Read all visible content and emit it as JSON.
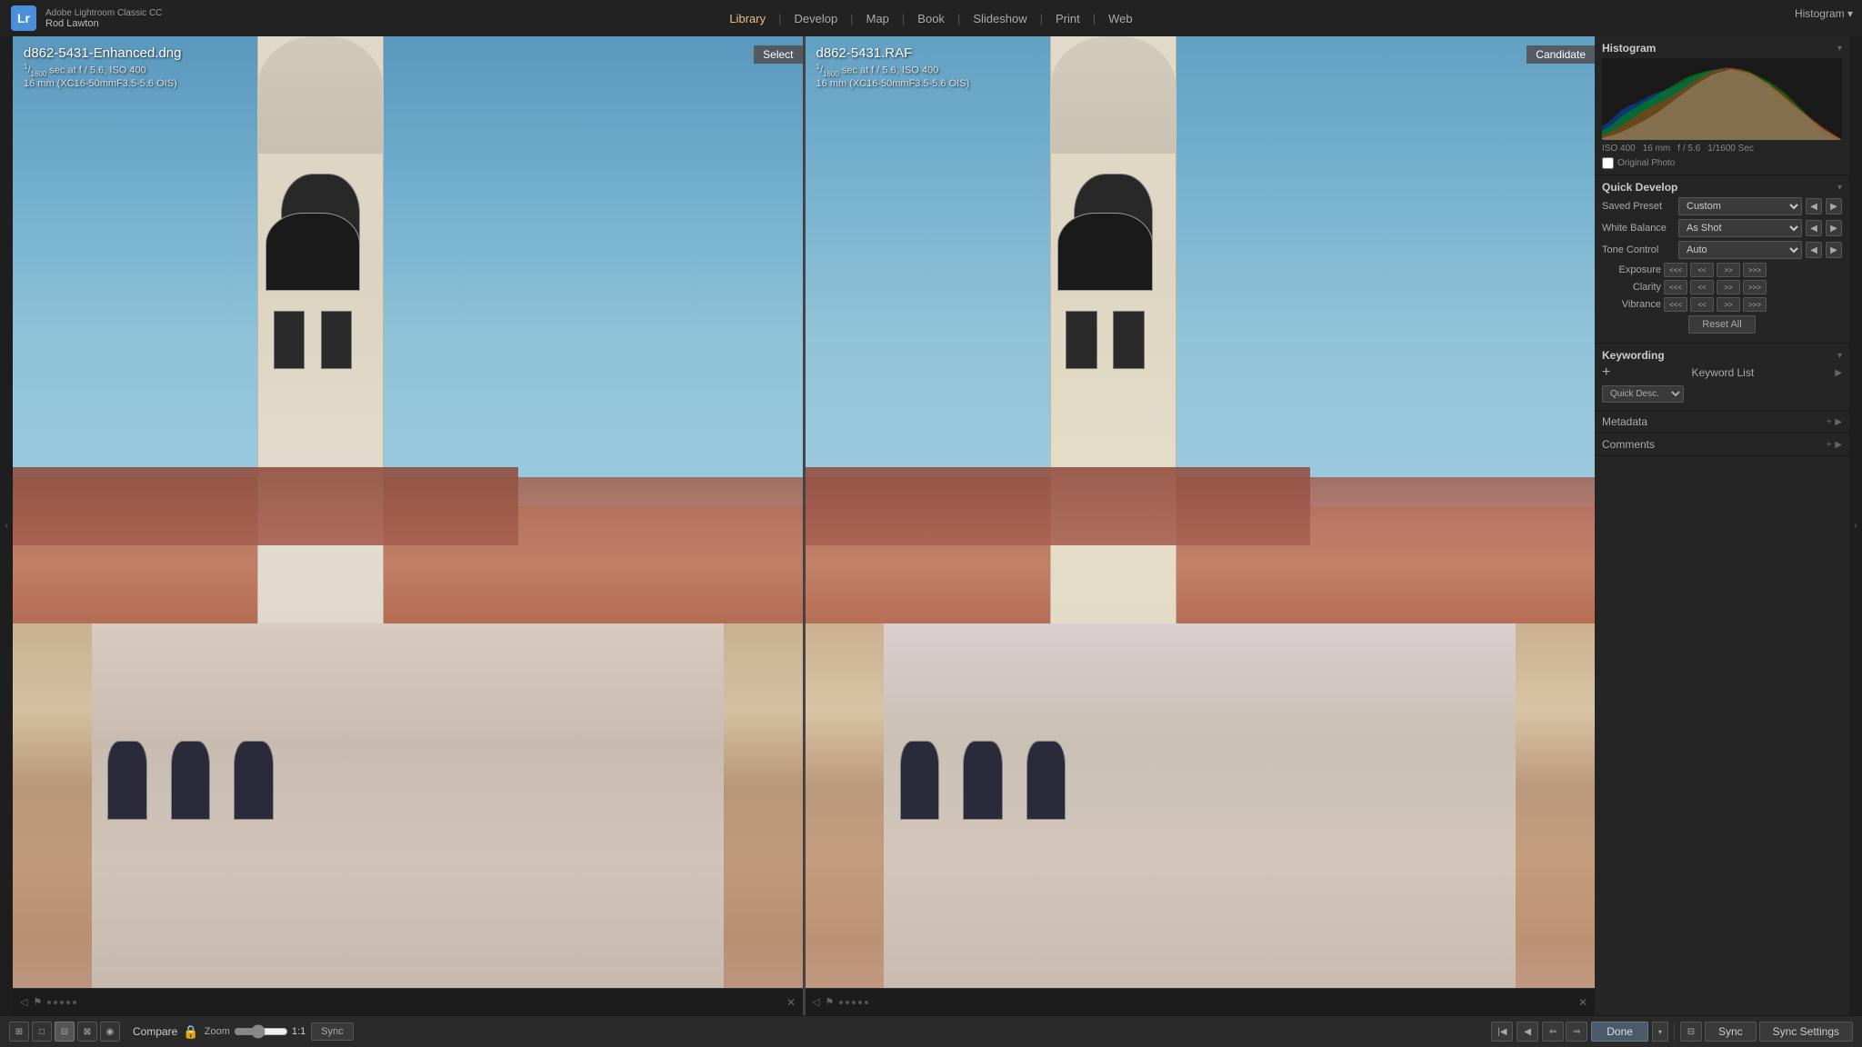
{
  "app": {
    "logo": "Lr",
    "title": "Adobe Lightroom Classic CC",
    "user": "Rod Lawton"
  },
  "nav": {
    "items": [
      {
        "label": "Library",
        "active": true
      },
      {
        "label": "Develop",
        "active": false
      },
      {
        "label": "Map",
        "active": false
      },
      {
        "label": "Book",
        "active": false
      },
      {
        "label": "Slideshow",
        "active": false
      },
      {
        "label": "Print",
        "active": false
      },
      {
        "label": "Web",
        "active": false
      }
    ]
  },
  "left_photo": {
    "filename": "d862-5431-Enhanced.dng",
    "shutter": "1/1600",
    "aperture": "f / 5.6",
    "iso": "ISO 400",
    "lens": "16 mm (XC16-50mmF3.5-5.6 OIS)",
    "badge": "Select"
  },
  "right_photo": {
    "filename": "d862-5431.RAF",
    "shutter": "1/1600",
    "aperture": "f / 5.6",
    "iso": "ISO 400",
    "lens": "16 mm (XC16-50mmF3.5-5.6 OIS)",
    "badge": "Candidate"
  },
  "histogram": {
    "title": "Histogram",
    "meta": [
      "ISO 400",
      "16 mm",
      "f / 5.6",
      "1/1600 Sec"
    ],
    "original_photo_label": "Original Photo"
  },
  "quick_develop": {
    "title": "Quick Develop",
    "saved_preset_label": "Saved Preset",
    "saved_preset_value": "Custom",
    "white_balance_label": "White Balance",
    "white_balance_value": "As Shot",
    "tone_control_label": "Tone Control",
    "tone_control_value": "Auto",
    "exposure_label": "Exposure",
    "clarity_label": "Clarity",
    "vibrance_label": "Vibrance",
    "reset_all_label": "Reset All",
    "adj_labels": [
      "<<<",
      "<<",
      ">>",
      ">>>"
    ]
  },
  "keywording": {
    "title": "Keywording",
    "keyword_list_label": "Keyword List",
    "add_label": "+"
  },
  "quick_desc": {
    "label": "Quick Desc.",
    "dropdown": "▾"
  },
  "metadata": {
    "label": "Metadata",
    "toggle": "+"
  },
  "comments": {
    "label": "Comments",
    "toggle": "+"
  },
  "toolbar": {
    "compare_label": "Compare",
    "zoom_label": "Zoom",
    "zoom_value": "1:1",
    "sync_label": "Sync",
    "done_label": "Done",
    "sync_settings_label": "Sync Settings",
    "sync_panel_label": "Sync"
  },
  "filmstrip": {
    "left_dots": [
      "·",
      "·",
      "·",
      "·",
      "·"
    ],
    "right_dots": [
      "·",
      "·",
      "·",
      "·",
      "·"
    ]
  }
}
